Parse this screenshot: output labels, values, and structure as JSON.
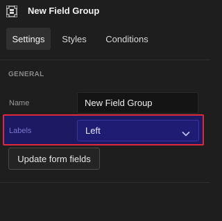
{
  "header": {
    "title": "New Field Group",
    "icon": "field-group-icon"
  },
  "tabs": [
    {
      "label": "Settings",
      "active": true
    },
    {
      "label": "Styles",
      "active": false
    },
    {
      "label": "Conditions",
      "active": false
    }
  ],
  "general": {
    "section_title": "GENERAL",
    "name": {
      "label": "Name",
      "value": "New Field Group"
    },
    "labels": {
      "label": "Labels",
      "selected": "Left"
    },
    "update_button": "Update form fields"
  },
  "colors": {
    "background": "#1e1e1e",
    "highlight_row": "#1c1a63",
    "highlight_border": "#e0293c",
    "select_bg": "#1f1c74"
  }
}
